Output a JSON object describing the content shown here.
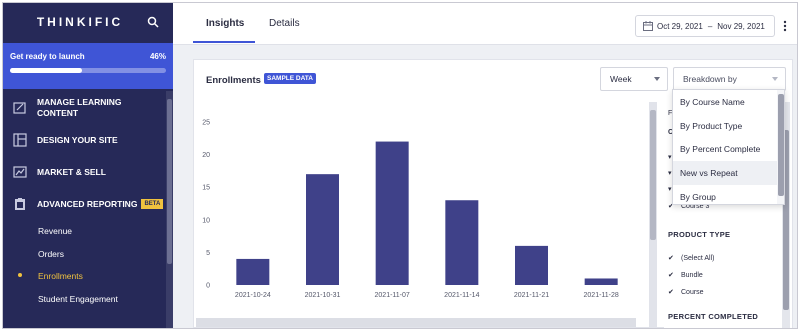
{
  "sidebar": {
    "brand": "THINKIFIC",
    "launch": {
      "label": "Get ready to launch",
      "percent_text": "46%",
      "progress": 0.46
    },
    "nav": [
      {
        "label": "MANAGE LEARNING CONTENT",
        "icon": "edit-icon"
      },
      {
        "label": "DESIGN YOUR SITE",
        "icon": "layout-icon"
      },
      {
        "label": "MARKET & SELL",
        "icon": "chart-icon"
      },
      {
        "label": "ADVANCED REPORTING",
        "icon": "clipboard-icon",
        "badge": "BETA"
      }
    ],
    "subnav": [
      "Revenue",
      "Orders",
      "Enrollments",
      "Student Engagement"
    ],
    "active_sub": "Enrollments"
  },
  "header": {
    "tabs": [
      "Insights",
      "Details"
    ],
    "active_tab": "Insights",
    "date_start": "Oct 29, 2021",
    "date_sep": "–",
    "date_end": "Nov 29, 2021"
  },
  "card": {
    "title": "Enrollments",
    "badge": "SAMPLE DATA",
    "period_select": "Week",
    "breakdown_select": "Breakdown by"
  },
  "breakdown_menu": {
    "options": [
      "By Course Name",
      "By Product Type",
      "By Percent Complete",
      "New vs Repeat",
      "By Group"
    ],
    "hovered": "New vs Repeat"
  },
  "filters": {
    "partial_label_1": "F",
    "partial_label_2": "C",
    "course_item": "Course 3",
    "product_type_header": "PRODUCT TYPE",
    "product_type_items": [
      "(Select All)",
      "Bundle",
      "Course"
    ],
    "percent_completed_header": "PERCENT COMPLETED"
  },
  "chart_data": {
    "type": "bar",
    "categories": [
      "2021-10-24",
      "2021-10-31",
      "2021-11-07",
      "2021-11-14",
      "2021-11-21",
      "2021-11-28"
    ],
    "values": [
      4,
      17,
      22,
      13,
      6,
      1
    ],
    "ylim": [
      0,
      25
    ],
    "yticks": [
      0,
      5,
      10,
      15,
      20,
      25
    ],
    "color": "#3f4189",
    "grid": false
  },
  "colors": {
    "sidebar_bg": "#262958",
    "launch_bg": "#3f55d6",
    "accent": "#3f55d6",
    "beta": "#f0c23e",
    "bar": "#3f4189"
  }
}
